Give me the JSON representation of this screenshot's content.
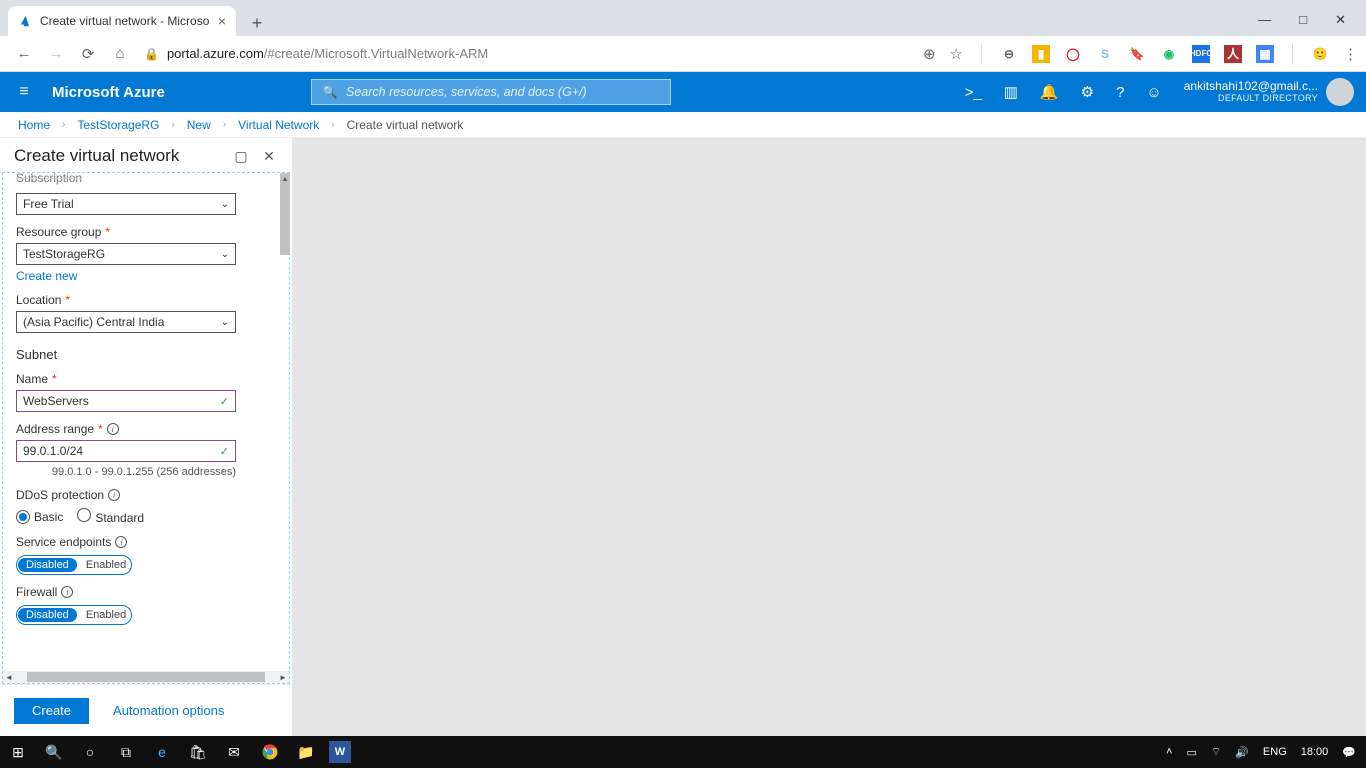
{
  "browser": {
    "tab_title": "Create virtual network - Microso",
    "url_host": "portal.azure.com",
    "url_path": "/#create/Microsoft.VirtualNetwork-ARM"
  },
  "azure": {
    "brand": "Microsoft Azure",
    "search_placeholder": "Search resources, services, and docs (G+/)",
    "user_email": "ankitshahi102@gmail.c...",
    "user_dir": "DEFAULT DIRECTORY"
  },
  "breadcrumb": {
    "items": [
      "Home",
      "TestStorageRG",
      "New",
      "Virtual Network"
    ],
    "current": "Create virtual network"
  },
  "blade": {
    "title": "Create virtual network",
    "subscription_label_cut": "Subscription",
    "subscription_value": "Free Trial",
    "rg_label": "Resource group",
    "rg_value": "TestStorageRG",
    "create_new": "Create new",
    "location_label": "Location",
    "location_value": "(Asia Pacific) Central India",
    "subnet_section": "Subnet",
    "name_label": "Name",
    "name_value": "WebServers",
    "addr_label": "Address range",
    "addr_value": "99.0.1.0/24",
    "addr_hint": "99.0.1.0 - 99.0.1.255 (256 addresses)",
    "ddos_label": "DDoS protection",
    "ddos_basic": "Basic",
    "ddos_std": "Standard",
    "svc_label": "Service endpoints",
    "fw_label": "Firewall",
    "toggle_disabled": "Disabled",
    "toggle_enabled": "Enabled",
    "create_btn": "Create",
    "automation": "Automation options"
  },
  "taskbar": {
    "lang": "ENG",
    "time": "18:00"
  }
}
